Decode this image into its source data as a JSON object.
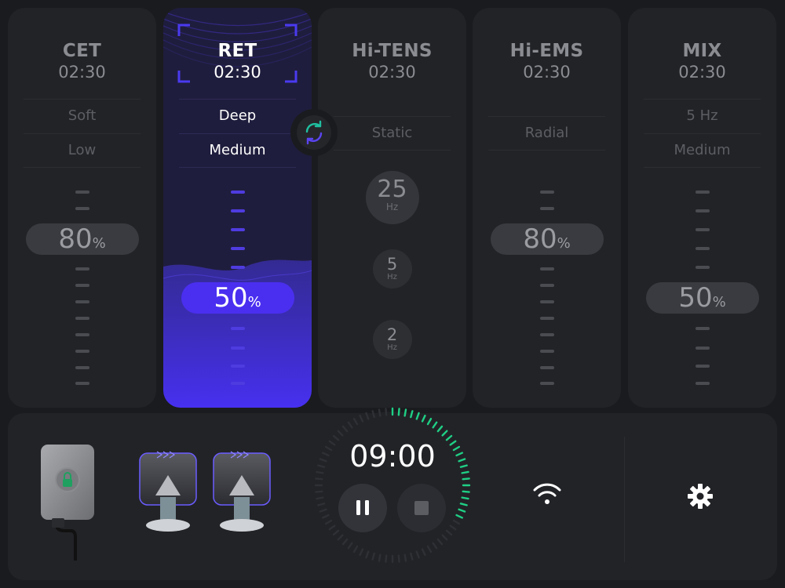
{
  "modes": [
    {
      "key": "cet",
      "name": "CET",
      "time": "02:30",
      "options": [
        "Soft",
        "Low"
      ],
      "intensity": "80",
      "intensity_fraction": 0.8
    },
    {
      "key": "ret",
      "name": "RET",
      "time": "02:30",
      "options": [
        "Deep",
        "Medium"
      ],
      "intensity": "50",
      "intensity_fraction": 0.5,
      "active": true
    },
    {
      "key": "hitens",
      "name": "Hi-TENS",
      "time": "02:30",
      "options": [
        "Static"
      ],
      "frequencies": [
        {
          "value": "25",
          "unit": "Hz",
          "selected": true
        },
        {
          "value": "5",
          "unit": "Hz"
        },
        {
          "value": "2",
          "unit": "Hz"
        }
      ]
    },
    {
      "key": "hiems",
      "name": "Hi-EMS",
      "time": "02:30",
      "options": [
        "Radial"
      ],
      "intensity": "80",
      "intensity_fraction": 0.8
    },
    {
      "key": "mix",
      "name": "MIX",
      "time": "02:30",
      "options": [
        "5 Hz",
        "Medium"
      ],
      "intensity": "50",
      "intensity_fraction": 0.5
    }
  ],
  "percent_symbol": "%",
  "timer": {
    "display": "09:00",
    "progress_fraction": 0.33
  },
  "colors": {
    "accent": "#4a2ff0",
    "accent_tick": "#4f3ce0",
    "timer_green": "#1fcf85",
    "background": "#1a1b1e",
    "panel": "#222327",
    "lock_green": "#1fa060"
  },
  "icons": {
    "swap": "swap-arrows-icon",
    "pause": "pause-icon",
    "stop": "stop-icon",
    "wifi": "wifi-icon",
    "settings": "gear-icon",
    "lock": "lock-icon"
  }
}
